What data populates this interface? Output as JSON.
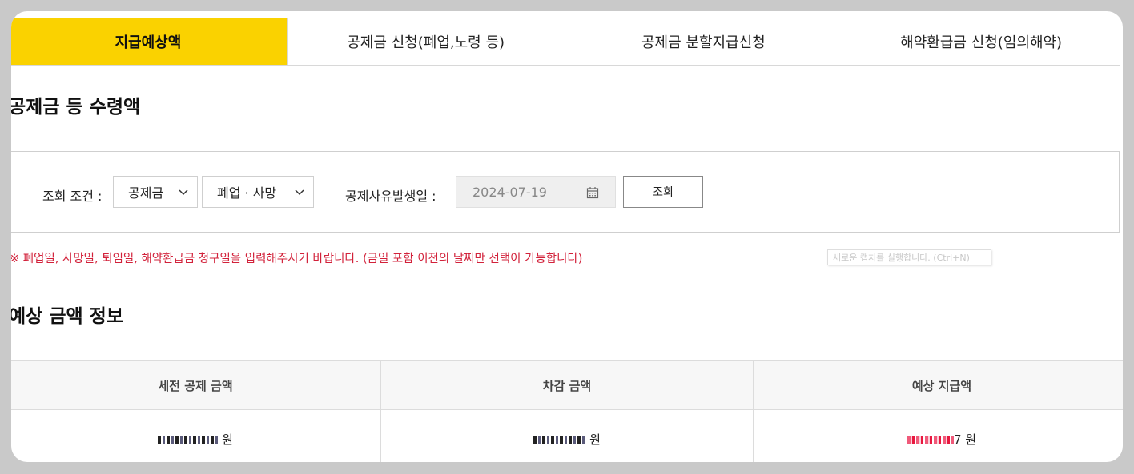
{
  "tabs": [
    {
      "label": "지급예상액",
      "active": true
    },
    {
      "label": "공제금 신청(폐업,노령 등)",
      "active": false
    },
    {
      "label": "공제금 분할지급신청",
      "active": false
    },
    {
      "label": "해약환급금 신청(임의해약)",
      "active": false
    }
  ],
  "section1": {
    "title": "공제금 등 수령액"
  },
  "search": {
    "condition_label": "조회 조건 :",
    "type_select": "공제금",
    "reason_select": "폐업 · 사망",
    "date_label": "공제사유발생일 :",
    "date_value": "2024-07-19",
    "search_button": "조회"
  },
  "notice": "※ 폐업일, 사망일, 퇴임일, 해약환급금 청구일을 입력해주시기 바랍니다. (금일 포함 이전의 날짜만 선택이 가능합니다)",
  "tooltip": "새로운 캡처를 실행합니다. (Ctrl+N)",
  "section2": {
    "title": "예상 금액 정보"
  },
  "table": {
    "headers": [
      "세전 공제 금액",
      "차감 금액",
      "예상 지급액"
    ],
    "row": {
      "col1_suffix": "원",
      "col2_suffix": "원",
      "col3_visible": "7 원"
    }
  },
  "colors": {
    "accent": "#fad200",
    "notice": "#d2213a",
    "highlight": "#e8183f"
  }
}
